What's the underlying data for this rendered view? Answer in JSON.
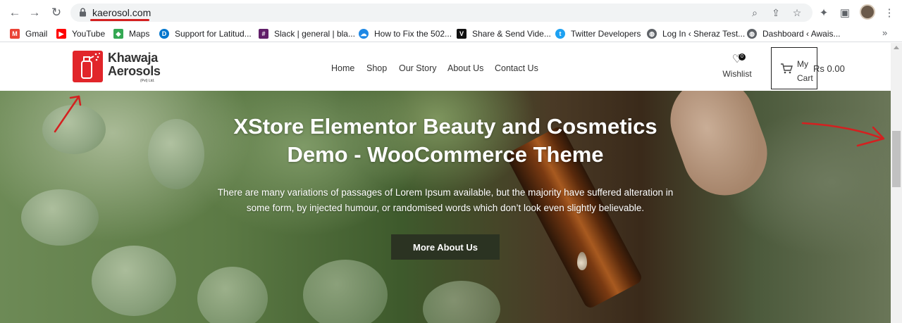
{
  "browser": {
    "url": "kaerosol.com",
    "bookmarks": [
      {
        "label": "Gmail",
        "icon": "gmail-icon",
        "color": "#ea4335",
        "glyph": "M"
      },
      {
        "label": "YouTube",
        "icon": "youtube-icon",
        "color": "#ff0000",
        "glyph": "▶"
      },
      {
        "label": "Maps",
        "icon": "maps-icon",
        "color": "#34a853",
        "glyph": "◆"
      },
      {
        "label": "Support for Latitud...",
        "icon": "dell-icon",
        "color": "#0076ce",
        "glyph": "D"
      },
      {
        "label": "Slack | general | bla...",
        "icon": "slack-icon",
        "color": "#611f69",
        "glyph": "#"
      },
      {
        "label": "How to Fix the 502...",
        "icon": "cloud-icon",
        "color": "#1e88e5",
        "glyph": "☁"
      },
      {
        "label": "Share & Send Vide...",
        "icon": "v-icon",
        "color": "#111111",
        "glyph": "V"
      },
      {
        "label": "Twitter Developers",
        "icon": "twitter-icon",
        "color": "#1da1f2",
        "glyph": "t"
      },
      {
        "label": "Log In ‹ Sheraz Test...",
        "icon": "globe-icon",
        "color": "#5f6368",
        "glyph": "◍"
      },
      {
        "label": "Dashboard ‹ Awais...",
        "icon": "globe-icon",
        "color": "#5f6368",
        "glyph": "◍"
      }
    ]
  },
  "site": {
    "logo_line1": "Khawaja",
    "logo_line2": "Aerosols",
    "logo_sub": "(Pvt) Ltd.",
    "nav": [
      "Home",
      "Shop",
      "Our Story",
      "About Us",
      "Contact Us"
    ],
    "wishlist_label": "Wishlist",
    "wishlist_count": "0",
    "cart_label_1": "My",
    "cart_label_2": "Cart",
    "cart_total": "Rs 0.00"
  },
  "hero": {
    "title_line1": "XStore Elementor Beauty and Cosmetics",
    "title_line2": "Demo - WooCommerce Theme",
    "text_line1": "There are many variations of passages of Lorem Ipsum available, but the majority have suffered alteration in",
    "text_line2": "some form, by injected humour, or randomised words which don’t look even slightly believable.",
    "button": "More About Us"
  },
  "colors": {
    "annotation": "#d42020",
    "logo_red": "#e1252a",
    "button_bg": "#2b3322"
  }
}
